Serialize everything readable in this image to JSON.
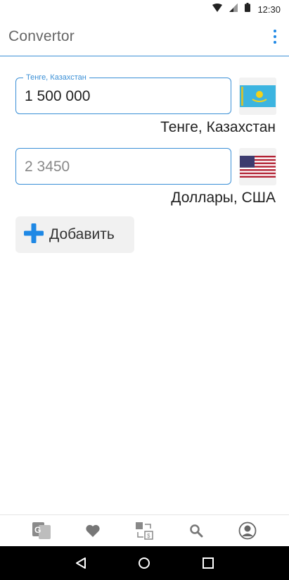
{
  "status_bar": {
    "time": "12:30",
    "icons": [
      "wifi-icon",
      "signal-icon",
      "battery-icon"
    ]
  },
  "app_bar": {
    "title": "Convertor",
    "menu_icon": "more-vert-icon"
  },
  "converters": [
    {
      "field_label": "Тенге, Казахстан",
      "value": "1 500 000",
      "placeholder": "",
      "currency_name": "Тенге, Казахстан",
      "flag": "kazakhstan-flag-icon"
    },
    {
      "field_label": "",
      "value": "",
      "placeholder": "2 3450",
      "currency_name": "Доллары, США",
      "flag": "usa-flag-icon"
    }
  ],
  "add_button": {
    "label": "Добавить",
    "icon": "plus-icon"
  },
  "bottom_nav": {
    "items": [
      {
        "icon": "translate-icon"
      },
      {
        "icon": "heart-icon"
      },
      {
        "icon": "currency-exchange-icon"
      },
      {
        "icon": "search-icon"
      },
      {
        "icon": "account-icon"
      }
    ]
  },
  "system_nav": {
    "items": [
      {
        "icon": "back-icon"
      },
      {
        "icon": "home-icon"
      },
      {
        "icon": "recents-icon"
      }
    ]
  },
  "colors": {
    "accent": "#3a8fd6",
    "menu_dots": "#1e88e5",
    "plus": "#1e88e5",
    "title": "#666666",
    "button_bg": "#f1f1f1"
  }
}
